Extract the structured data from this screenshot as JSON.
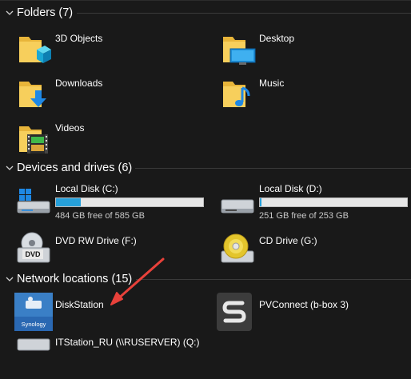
{
  "groups": {
    "folders": {
      "title": "Folders (7)"
    },
    "devices": {
      "title": "Devices and drives (6)"
    },
    "network": {
      "title": "Network locations (15)"
    }
  },
  "folders": [
    {
      "name": "3D Objects",
      "icon": "3d-objects-folder-icon"
    },
    {
      "name": "Desktop",
      "icon": "desktop-folder-icon"
    },
    {
      "name": "Downloads",
      "icon": "downloads-folder-icon"
    },
    {
      "name": "Music",
      "icon": "music-folder-icon"
    },
    {
      "name": "Videos",
      "icon": "videos-folder-icon"
    }
  ],
  "drives": [
    {
      "name": "Local Disk (C:)",
      "free": "484 GB free of 585 GB",
      "used_fraction": 0.17,
      "icon": "windows-drive-icon"
    },
    {
      "name": "Local Disk (D:)",
      "free": "251 GB free of 253 GB",
      "used_fraction": 0.01,
      "icon": "hard-drive-icon"
    },
    {
      "name": "DVD RW Drive (F:)",
      "icon": "dvd-drive-icon"
    },
    {
      "name": "CD Drive (G:)",
      "icon": "cd-drive-icon"
    }
  ],
  "network": [
    {
      "name": "DiskStation",
      "icon": "synology-icon",
      "icon_text": "Synology"
    },
    {
      "name": "PVConnect (b-box 3)",
      "icon": "pvconnect-icon"
    },
    {
      "name": "ITStation_RU (\\\\RUSERVER) (Q:)",
      "icon": "network-drive-icon"
    }
  ],
  "colors": {
    "background": "#191919",
    "bar_fill": "#26a0da",
    "annotation_arrow": "#e8413a"
  }
}
